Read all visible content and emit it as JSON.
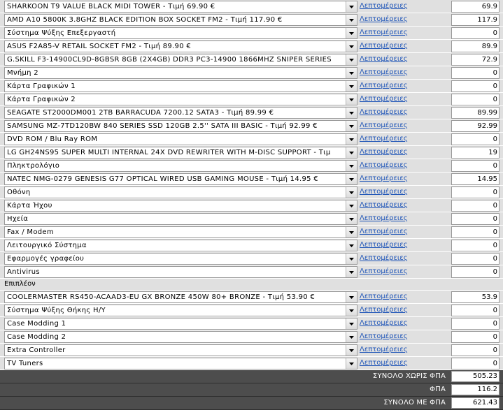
{
  "details_label": "Λεπτομέρειες",
  "rows_main": [
    {
      "selected": "SHARKOON T9 VALUE BLACK MIDI TOWER - Τιμή 69.90 €",
      "price": "69.9"
    },
    {
      "selected": "AMD A10 5800K 3.8GHZ BLACK EDITION BOX SOCKET FM2 - Τιμή 117.90 €",
      "price": "117.9"
    },
    {
      "selected": "Σύστημα Ψύξης Επεξεργαστή",
      "price": "0"
    },
    {
      "selected": "ASUS F2A85-V RETAIL SOCKET FM2 - Τιμή 89.90 €",
      "price": "89.9"
    },
    {
      "selected": "G.SKILL F3-14900CL9D-8GBSR 8GB (2X4GB) DDR3 PC3-14900 1866MHZ SNIPER SERIES",
      "price": "72.9"
    },
    {
      "selected": "Μνήμη 2",
      "price": "0"
    },
    {
      "selected": "Κάρτα Γραφικών 1",
      "price": "0"
    },
    {
      "selected": "Κάρτα Γραφικών 2",
      "price": "0"
    },
    {
      "selected": "SEAGATE ST2000DM001 2TB BARRACUDA 7200.12 SATA3 - Τιμή 89.99 €",
      "price": "89.99"
    },
    {
      "selected": "SAMSUNG MZ-7TD120BW 840 SERIES SSD 120GB 2.5'' SATA III BASIC - Τιμή 92.99 €",
      "price": "92.99"
    },
    {
      "selected": "DVD ROM / Blu Ray ROM",
      "price": "0"
    },
    {
      "selected": "LG GH24NS95 SUPER MULTI INTERNAL 24X DVD REWRITER WITH M-DISC SUPPORT - Τιμ",
      "price": "19"
    },
    {
      "selected": "Πληκτρολόγιο",
      "price": "0"
    },
    {
      "selected": "NATEC NMG-0279 GENESIS G77 OPTICAL WIRED USB GAMING MOUSE - Τιμή 14.95 €",
      "price": "14.95"
    },
    {
      "selected": "Οθόνη",
      "price": "0"
    },
    {
      "selected": "Κάρτα Ήχου",
      "price": "0"
    },
    {
      "selected": "Ηχεία",
      "price": "0"
    },
    {
      "selected": "Fax / Modem",
      "price": "0"
    },
    {
      "selected": "Λειτουργικό Σύστημα",
      "price": "0"
    },
    {
      "selected": "Εφαρμογές γραφείου",
      "price": "0"
    },
    {
      "selected": "Antivirus",
      "price": "0"
    }
  ],
  "extras_label": "Επιπλέον",
  "rows_extra": [
    {
      "selected": "COOLERMASTER RS450-ACAAD3-EU GX BRONZE 450W 80+ BRONZE - Τιμή 53.90 €",
      "price": "53.9"
    },
    {
      "selected": "Σύστημα Ψύξης Θήκης Η/Υ",
      "price": "0"
    },
    {
      "selected": "Case Modding 1",
      "price": "0"
    },
    {
      "selected": "Case Modding 2",
      "price": "0"
    },
    {
      "selected": "Extra Controller",
      "price": "0"
    },
    {
      "selected": "TV Tuners",
      "price": "0"
    }
  ],
  "totals": [
    {
      "label": "ΣΥΝΟΛΟ ΧΩΡΙΣ ΦΠΑ",
      "value": "505.23"
    },
    {
      "label": "ΦΠΑ",
      "value": "116.2"
    },
    {
      "label": "ΣΥΝΟΛΟ ΜΕ ΦΠΑ",
      "value": "621.43"
    }
  ],
  "colors": {
    "link": "#1f55b8",
    "row_bg": "#e0e0e0",
    "totals_bg": "#4d4d4d"
  }
}
